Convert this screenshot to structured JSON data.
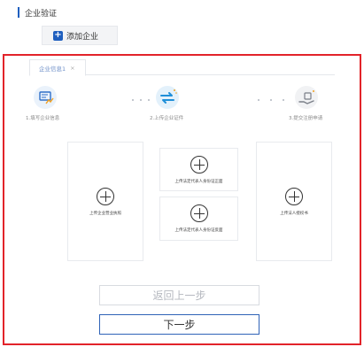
{
  "section": {
    "title": "企业验证"
  },
  "add_button": {
    "icon": "plus-icon",
    "label": "添加企业"
  },
  "tabs": [
    {
      "label": "企业信息1",
      "close": "×"
    }
  ],
  "steps": [
    {
      "label": "1.填写企业信息",
      "icon": "document-chart-icon"
    },
    {
      "label": "2.上传企业证件",
      "icon": "exchange-arrows-icon"
    },
    {
      "label": "3.提交注册申请",
      "icon": "hand-submit-icon"
    }
  ],
  "uploads": {
    "business_license": "上传企业营业执照",
    "legal_id_front": "上传法定代表人身份证正面",
    "legal_id_back": "上传法定代表人身份证反面",
    "authorization": "上传法人授权书"
  },
  "buttons": {
    "prev": "返回上一步",
    "next": "下一步"
  },
  "colors": {
    "accent": "#1f5fbf",
    "highlight_border": "#e2232a"
  }
}
